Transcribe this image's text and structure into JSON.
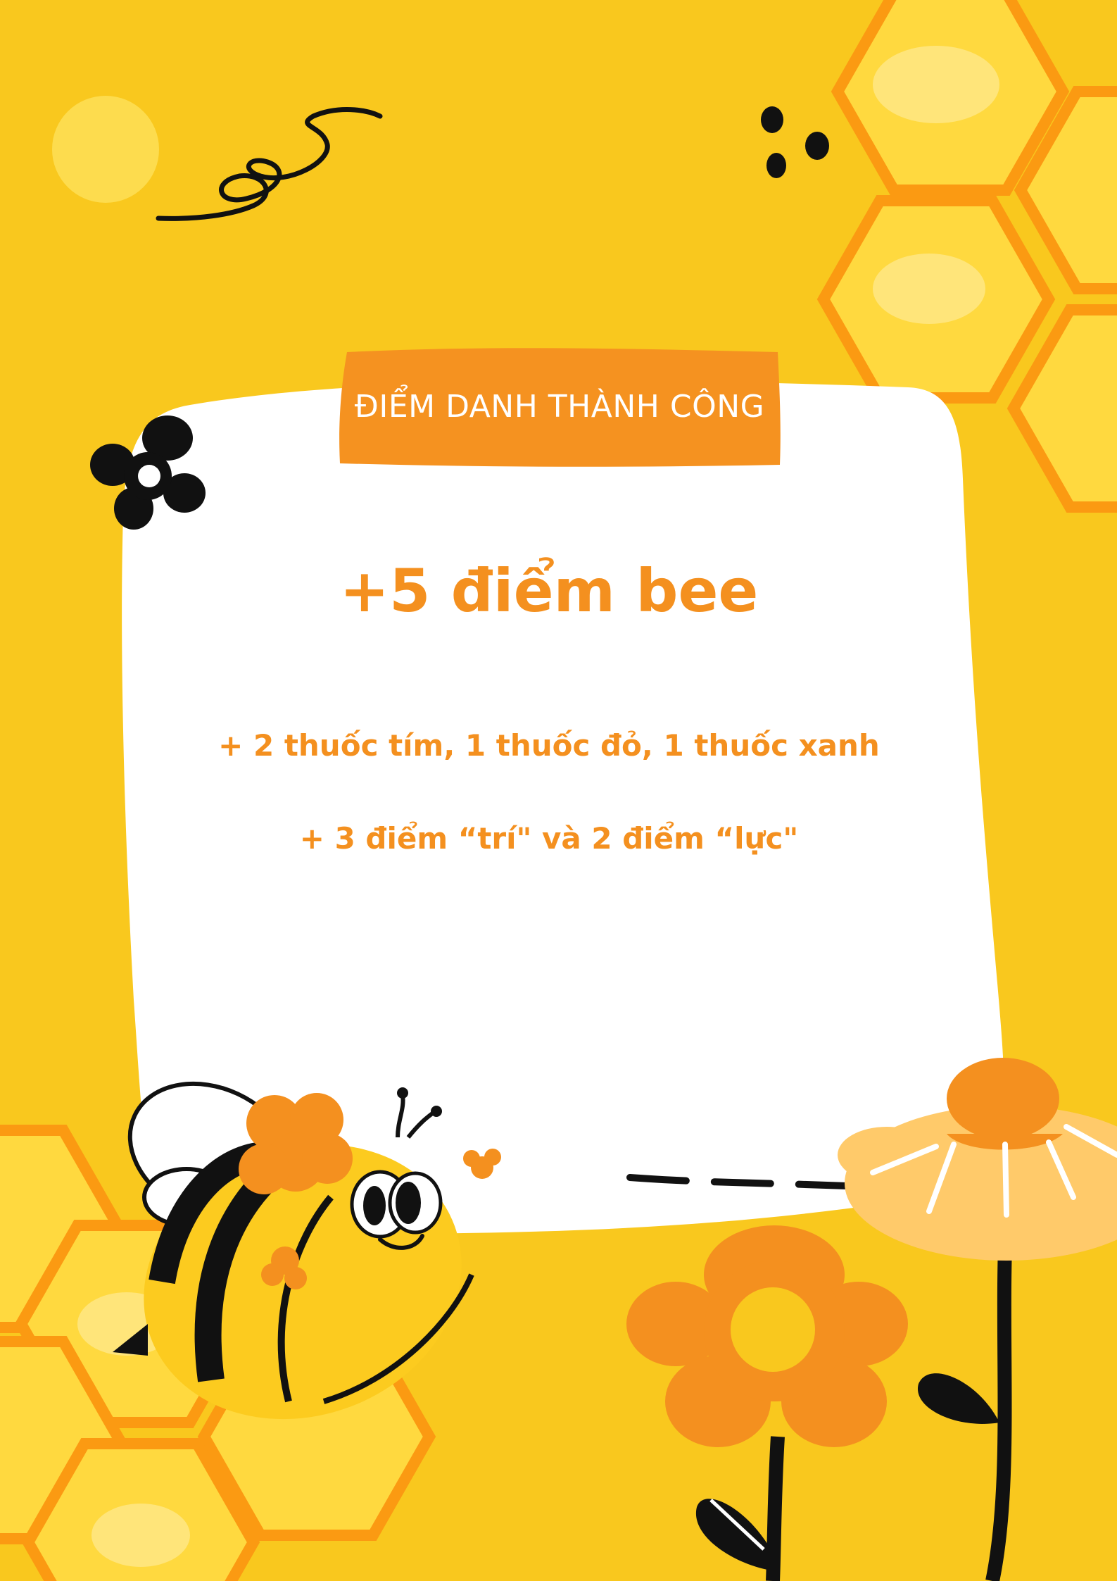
{
  "banner": {
    "label": "ĐIỂM DANH THÀNH CÔNG"
  },
  "headline": "+5 điểm bee",
  "rewards": [
    "+ 2 thuốc tím, 1 thuốc đỏ, 1 thuốc xanh",
    "+ 3 điểm “trí\" và  2 điểm “lực\""
  ],
  "colors": {
    "background": "#f9c81e",
    "accent_orange": "#f4901f",
    "honeycomb_fill": "#ffd93f",
    "card": "#ffffff",
    "ink": "#111111"
  },
  "icons": [
    "honeycomb",
    "bee",
    "flower",
    "daisy",
    "squiggle",
    "dots",
    "butterfly-flower"
  ]
}
